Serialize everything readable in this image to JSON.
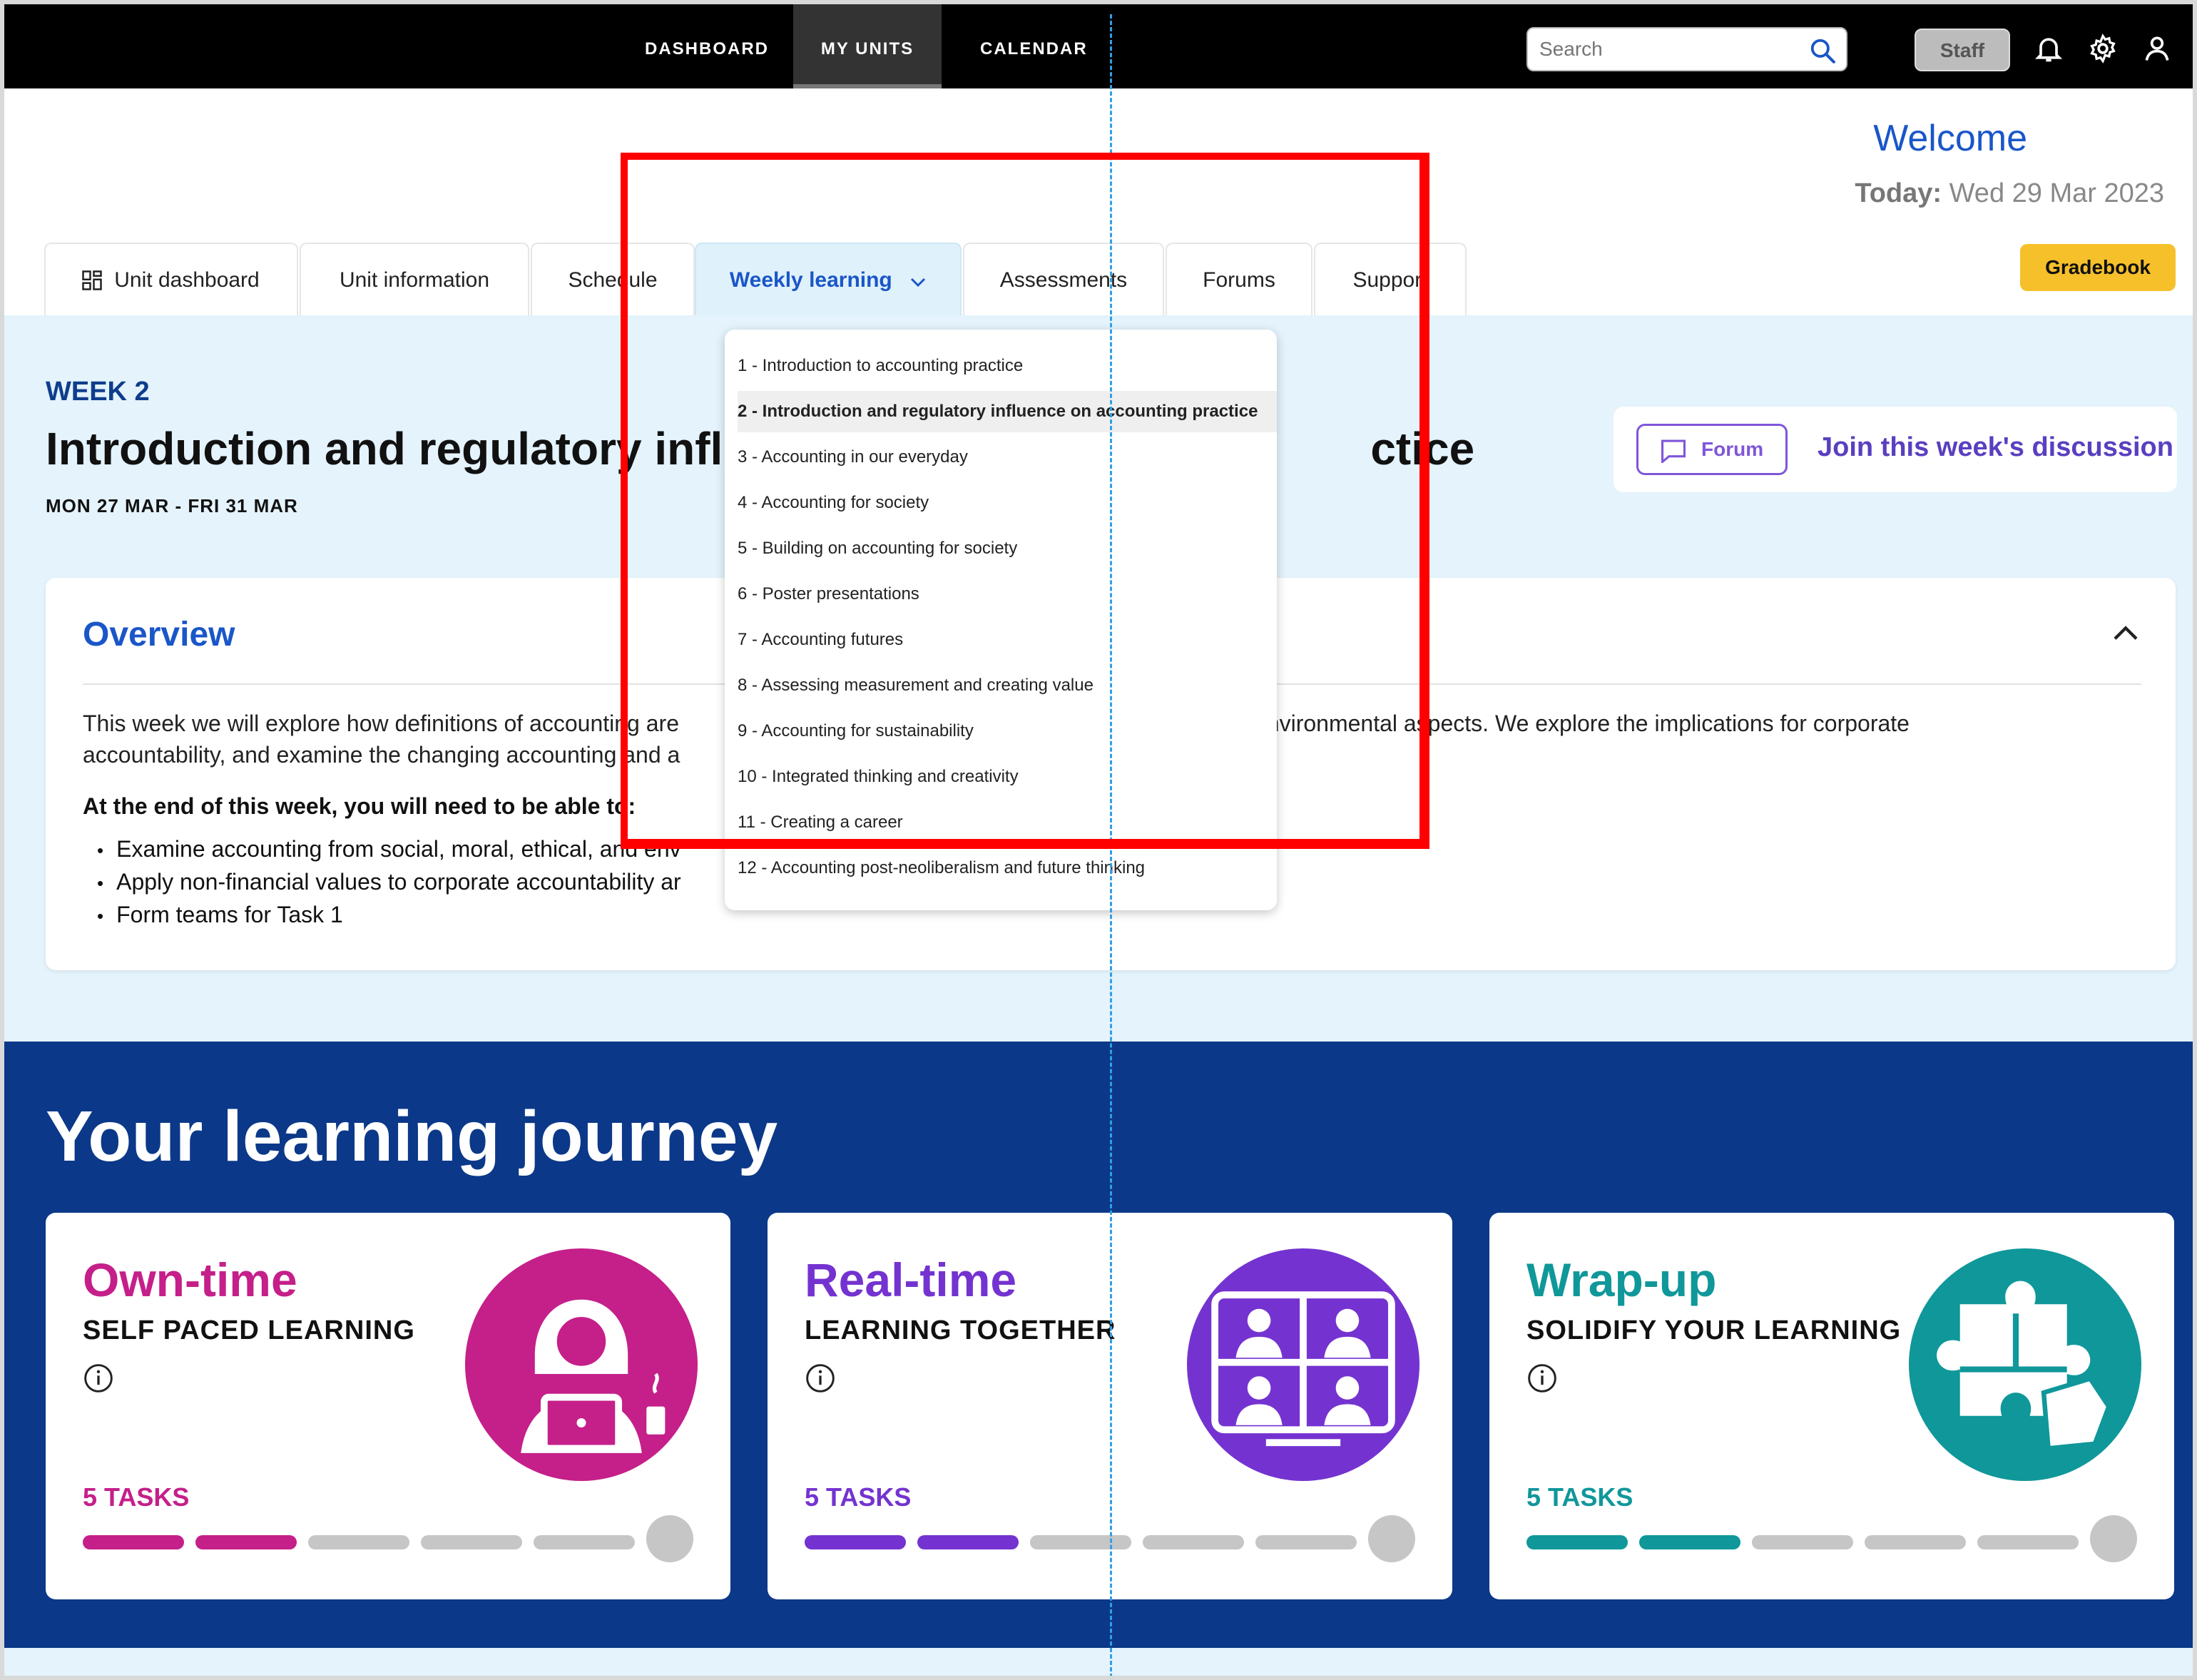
{
  "topnav": {
    "items": [
      "DASHBOARD",
      "MY UNITS",
      "CALENDAR"
    ],
    "active": "MY UNITS",
    "search_placeholder": "Search",
    "staff_label": "Staff",
    "icons": [
      "bell-icon",
      "gear-icon",
      "user-icon"
    ]
  },
  "header": {
    "welcome": "Welcome",
    "today_label": "Today:",
    "today_value": "Wed 29 Mar 2023",
    "gradebook": "Gradebook"
  },
  "tabs": [
    {
      "label": "Unit dashboard",
      "icon": "dashboard-icon"
    },
    {
      "label": "Unit information"
    },
    {
      "label": "Schedule"
    },
    {
      "label": "Weekly learning",
      "icon": "chevron-down-icon",
      "active": true
    },
    {
      "label": "Assessments"
    },
    {
      "label": "Forums"
    },
    {
      "label": "Support"
    }
  ],
  "week": {
    "label": "WEEK 2",
    "title_start": "Introduction and regulatory infl",
    "title_end": "ctice",
    "dates": "MON 27 MAR - FRI 31 MAR"
  },
  "forum": {
    "button": "Forum",
    "link": "Join this week's discussion"
  },
  "overview": {
    "title": "Overview",
    "text_line1_a": "This week we will explore how definitions of acco",
    "text_line1_b": "unting are",
    "text_line1_c": "l environmental aspects. We explore the implications for corporate",
    "text_line2_a": "accountability, and examine the changing accoun",
    "text_line2_b": "ting and a",
    "subheading": "At the end of this week, you will need to be able to:",
    "bullets": [
      "Examine accounting from social, moral, ethical, and env",
      "Apply non-financial values to corporate accountability ar",
      "Form teams for Task 1"
    ]
  },
  "weekly_dropdown": {
    "items": [
      "1 - Introduction to accounting practice",
      "2 - Introduction and regulatory influence on accounting practice",
      "3 - Accounting in our everyday",
      "4 - Accounting for society",
      "5 - Building on accounting for society",
      "6 - Poster presentations",
      "7 - Accounting futures",
      "8 - Assessing measurement and creating value",
      "9 - Accounting for sustainability",
      "10 - Integrated thinking and creativity",
      "11 - Creating a career",
      "12 - Accounting post-neoliberalism and future thinking"
    ],
    "selected_index": 1
  },
  "journey": {
    "title": "Your learning journey",
    "cards": [
      {
        "title": "Own-time",
        "subtitle": "SELF PACED LEARNING",
        "tasks": "5 TASKS",
        "color": "#c51f8a",
        "completed": 2,
        "total": 5,
        "icon": "self-paced-learner-icon"
      },
      {
        "title": "Real-time",
        "subtitle": "LEARNING TOGETHER",
        "tasks": "5 TASKS",
        "color": "#7433d0",
        "completed": 2,
        "total": 5,
        "icon": "video-conference-icon"
      },
      {
        "title": "Wrap-up",
        "subtitle": "SOLIDIFY YOUR LEARNING",
        "tasks": "5 TASKS",
        "color": "#10979a",
        "completed": 2,
        "total": 5,
        "icon": "puzzle-icon"
      }
    ]
  },
  "colors": {
    "topbar": "#000000",
    "accent_blue": "#1a56c8",
    "journey_bg": "#0b3888",
    "light_bg": "#e4f3fc",
    "gradebook": "#f6c02a",
    "forum_purple": "#7f56d9",
    "annotation_red": "#ff0000",
    "annotation_guide": "#2f9fe8"
  }
}
